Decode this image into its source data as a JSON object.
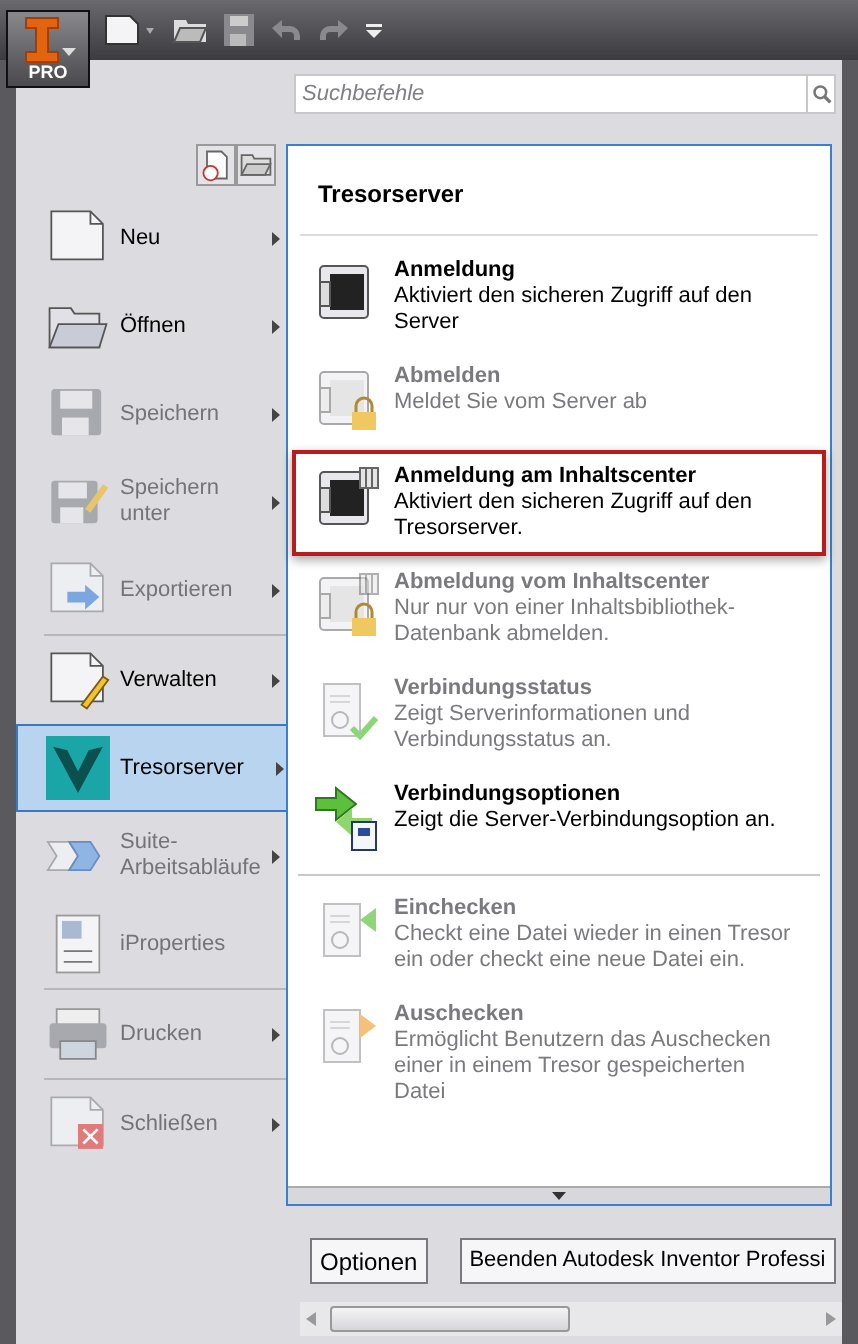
{
  "app_button": {
    "badge": "PRO"
  },
  "search": {
    "placeholder": "Suchbefehle"
  },
  "menu": [
    {
      "label": "Neu",
      "disabled": false,
      "submenu": true,
      "selected": false,
      "separator_before": false
    },
    {
      "label": "Öffnen",
      "disabled": false,
      "submenu": true,
      "selected": false,
      "separator_before": false
    },
    {
      "label": "Speichern",
      "disabled": true,
      "submenu": true,
      "selected": false,
      "separator_before": false
    },
    {
      "label": "Speichern unter",
      "disabled": true,
      "submenu": true,
      "selected": false,
      "separator_before": false
    },
    {
      "label": "Exportieren",
      "disabled": true,
      "submenu": true,
      "selected": false,
      "separator_before": false
    },
    {
      "label": "Verwalten",
      "disabled": false,
      "submenu": true,
      "selected": false,
      "separator_before": true
    },
    {
      "label": "Tresorserver",
      "disabled": false,
      "submenu": true,
      "selected": true,
      "separator_before": false
    },
    {
      "label": "Suite-Arbeitsabläufe",
      "disabled": true,
      "submenu": true,
      "selected": false,
      "separator_before": false
    },
    {
      "label": "iProperties",
      "disabled": true,
      "submenu": false,
      "selected": false,
      "separator_before": false
    },
    {
      "label": "Drucken",
      "disabled": true,
      "submenu": true,
      "selected": false,
      "separator_before": true
    },
    {
      "label": "Schließen",
      "disabled": true,
      "submenu": true,
      "selected": false,
      "separator_before": true
    }
  ],
  "submenu": {
    "title": "Tresorserver",
    "items": [
      {
        "title": "Anmeldung",
        "description": "Aktiviert den sicheren Zugriff auf den Server",
        "disabled": false,
        "highlighted": false,
        "separator_before": false
      },
      {
        "title": "Abmelden",
        "description": "Meldet Sie vom Server ab",
        "disabled": true,
        "highlighted": false,
        "separator_before": false
      },
      {
        "title": "Anmeldung am Inhaltscenter",
        "description": "Aktiviert den sicheren Zugriff auf den Tresorserver.",
        "disabled": false,
        "highlighted": true,
        "separator_before": false
      },
      {
        "title": "Abmeldung vom Inhaltscenter",
        "description": "Nur nur von einer Inhaltsbibliothek-Datenbank abmelden.",
        "disabled": true,
        "highlighted": false,
        "separator_before": false
      },
      {
        "title": "Verbindungsstatus",
        "description": "Zeigt Serverinformationen und Verbindungsstatus an.",
        "disabled": true,
        "highlighted": false,
        "separator_before": false
      },
      {
        "title": "Verbindungsoptionen",
        "description": "Zeigt die Server-Verbindungsoption an.",
        "disabled": false,
        "highlighted": false,
        "separator_before": false
      },
      {
        "title": "Einchecken",
        "description": "Checkt eine Datei wieder in einen Tresor ein oder checkt eine neue Datei ein.",
        "disabled": true,
        "highlighted": false,
        "separator_before": true
      },
      {
        "title": "Auschecken",
        "description": "Ermöglicht Benutzern das Auschecken einer in einem Tresor gespeicherten Datei",
        "disabled": true,
        "highlighted": false,
        "separator_before": false
      }
    ]
  },
  "buttons": [
    "Optionen",
    "Beenden Autodesk Inventor Professi"
  ]
}
